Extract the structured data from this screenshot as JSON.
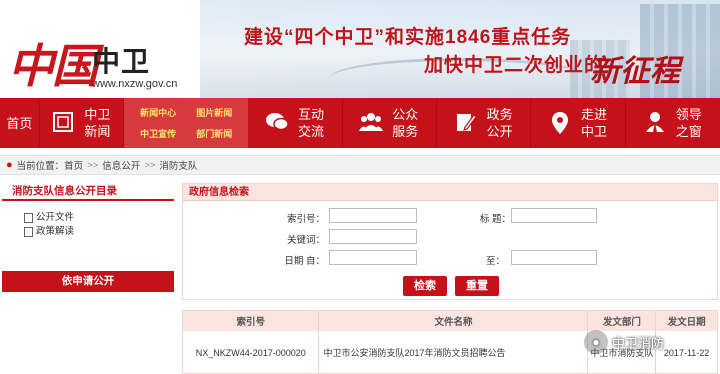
{
  "header": {
    "logo_mark": "中国",
    "logo_text": "中卫",
    "site_url": "www.nxzw.gov.cn",
    "slogan_line1": "建设“四个中卫”和实施1846重点任务",
    "slogan_line2": "加快中卫二次创业的",
    "slogan_art": "新征程"
  },
  "nav": {
    "home": "首页",
    "news": "中卫新闻",
    "sub": [
      "新闻中心",
      "图片新闻",
      "中卫宣传",
      "部门新闻"
    ],
    "items": [
      {
        "label": "互动交流",
        "icon": "chat-icon"
      },
      {
        "label": "公众服务",
        "icon": "people-icon"
      },
      {
        "label": "政务公开",
        "icon": "edit-icon"
      },
      {
        "label": "走进中卫",
        "icon": "location-icon"
      },
      {
        "label": "领导之窗",
        "icon": "leader-icon"
      }
    ]
  },
  "breadcrumb": {
    "prefix": "当前位置：",
    "items": [
      "首页",
      "信息公开",
      "消防支队"
    ]
  },
  "sidebar": {
    "title": "消防支队信息公开目录",
    "links": [
      "公开文件",
      "政策解读"
    ],
    "apply_button": "依申请公开"
  },
  "search": {
    "title": "政府信息检索",
    "index_label": "索引号：",
    "title_label": "标 题：",
    "keyword_label": "关键词：",
    "date_from_label": "日期 自：",
    "date_to_label": "至：",
    "search_button": "检索",
    "reset_button": "重置"
  },
  "table": {
    "headers": [
      "索引号",
      "文件名称",
      "发文部门",
      "发文日期"
    ],
    "rows": [
      [
        "NX_NKZW44-2017-000020",
        "中卫市公安消防支队2017年消防文员招聘公告",
        "中卫市消防支队",
        "2017-11-22"
      ]
    ]
  },
  "watermark": "中卫消防"
}
